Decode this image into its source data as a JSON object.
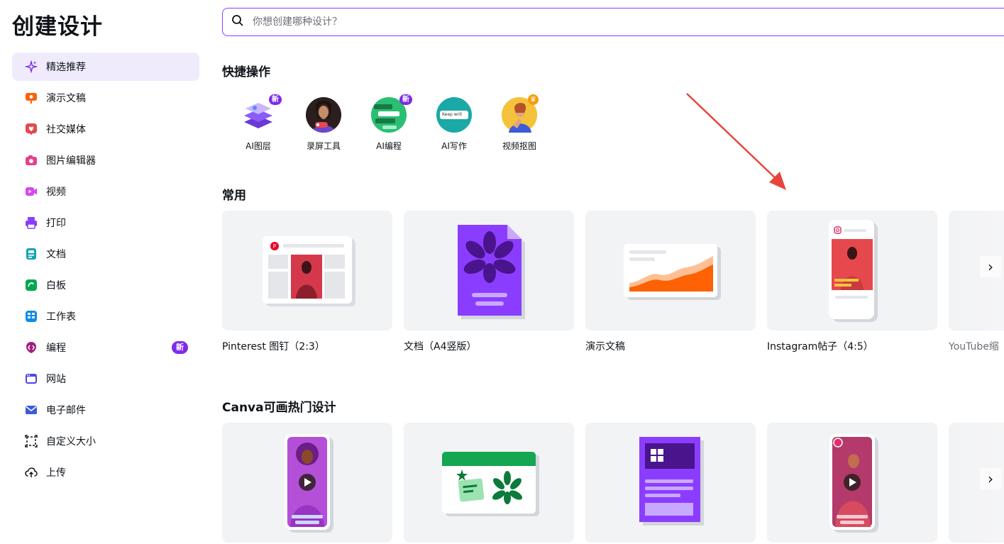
{
  "page_title": "创建设计",
  "search": {
    "placeholder": "你想创建哪种设计？"
  },
  "sidebar": {
    "items": [
      {
        "label": "精选推荐",
        "icon": "sparkle-icon",
        "color": "#7d2ae8"
      },
      {
        "label": "演示文稿",
        "icon": "presentation-icon",
        "color": "#ff6105"
      },
      {
        "label": "社交媒体",
        "icon": "heart-icon",
        "color": "#e5484d"
      },
      {
        "label": "图片编辑器",
        "icon": "camera-icon",
        "color": "#e83e8c"
      },
      {
        "label": "视频",
        "icon": "video-icon",
        "color": "#d946ef"
      },
      {
        "label": "打印",
        "icon": "printer-icon",
        "color": "#8b3dff"
      },
      {
        "label": "文档",
        "icon": "document-icon",
        "color": "#13a3b5"
      },
      {
        "label": "白板",
        "icon": "whiteboard-icon",
        "color": "#00a650"
      },
      {
        "label": "工作表",
        "icon": "spreadsheet-icon",
        "color": "#0b8ce9"
      },
      {
        "label": "编程",
        "icon": "code-icon",
        "color": "#a1207e",
        "badge": "新"
      },
      {
        "label": "网站",
        "icon": "website-icon",
        "color": "#4f46e5"
      },
      {
        "label": "电子邮件",
        "icon": "email-icon",
        "color": "#3b5bdb"
      },
      {
        "label": "自定义大小",
        "icon": "custom-size-icon",
        "color": "#0e1318"
      },
      {
        "label": "上传",
        "icon": "cloud-upload-icon",
        "color": "#0e1318"
      }
    ]
  },
  "quick_actions": {
    "title": "快捷操作",
    "items": [
      {
        "label": "AI图层",
        "badge": "新"
      },
      {
        "label": "录屏工具",
        "badge": ""
      },
      {
        "label": "AI编程",
        "badge": "新"
      },
      {
        "label": "AI写作",
        "badge": "",
        "snippet": "Keep writ"
      },
      {
        "label": "视频抠图",
        "badge": ""
      }
    ]
  },
  "common": {
    "title": "常用",
    "cards": [
      {
        "label": "Pinterest 图钉（2:3）"
      },
      {
        "label": "文档（A4竖版）"
      },
      {
        "label": "演示文稿"
      },
      {
        "label": "Instagram帖子（4:5）"
      },
      {
        "label": "YouTube缩"
      }
    ]
  },
  "popular": {
    "title": "Canva可画热门设计"
  },
  "colors": {
    "accent": "#8b3dff",
    "badge": "#7d2ae8",
    "annotation_arrow": "#e8453c"
  }
}
